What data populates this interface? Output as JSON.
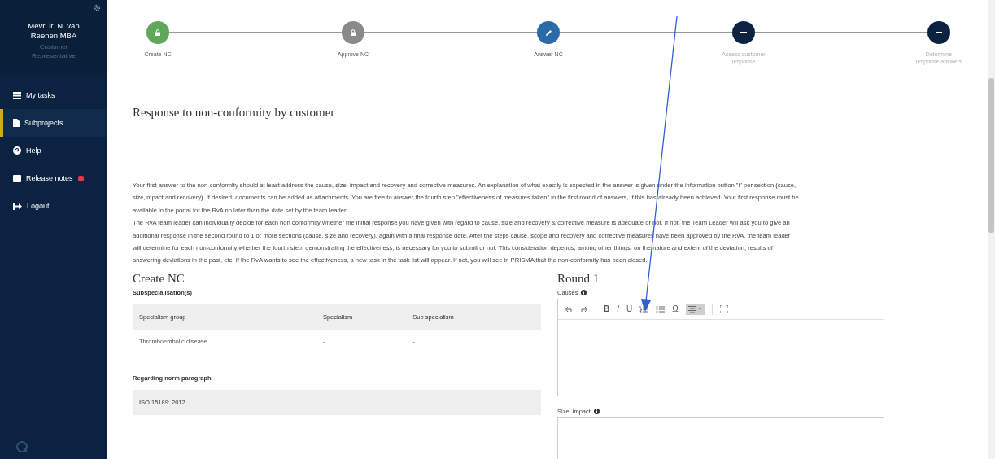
{
  "sidebar": {
    "user_name": "Mevr. ir. N. van Reenen MBA",
    "user_role": "Customer Representative",
    "items": [
      {
        "label": "My tasks",
        "selected": false,
        "badge": false
      },
      {
        "label": "Subprojects",
        "selected": true,
        "badge": false
      },
      {
        "label": "Help",
        "selected": false,
        "badge": false
      },
      {
        "label": "Release notes",
        "selected": false,
        "badge": true
      },
      {
        "label": "Logout",
        "selected": false,
        "badge": false
      }
    ]
  },
  "steps": [
    {
      "label": "Create NC",
      "kind": "done"
    },
    {
      "label": "Approve NC",
      "kind": "approved"
    },
    {
      "label": "Answer NC",
      "kind": "current"
    },
    {
      "label": "Assess customer response",
      "kind": "pending"
    },
    {
      "label": "Determine response answers",
      "kind": "pending"
    }
  ],
  "page_title": "Response to non-conformity by customer",
  "intro": [
    "Your first answer to the non-conformity should at least address the cause, size, impact and recovery and corrective measures. An explanation of what exactly is expected in the answer is given under the information button \"i\" per section (cause, size,impact and recovery). If desired, documents can be added as attachments. You are free to answer the fourth step \"effectiveness of measures taken\" in the first round of answers, if this has already been achieved. Your first response must be available in the portal for the RvA no later than the date set by the team leader.",
    "The RvA team leader can individually decide for each non conformity whether the initial response you have given with regard to cause, size and recovery & corrective measure is adequate or not. If not, the Team Leader will ask you to give an additional response in the second round to 1 or more sections (cause, size and recovery), again with a final response date. After the steps cause, scope and recovery and corrective measures have been approved by the RvA, the team leader will determine for each non-conformity whether the fourth step, demonstrating the effectiveness, is necessary for you to submit or not. This consideration depends, among other things, on the nature and extent of the deviation, results of answering deviations in the past, etc. If the RvA wants to see the effectiveness, a new task in the task list will appear. If not, you will see in PRISMA that the non-conformity has been closed."
  ],
  "create_nc": {
    "title": "Create NC",
    "subspecialisations_label": "Subspecialisation(s)",
    "table": {
      "columns": [
        "Specialism group",
        "Specialism",
        "Sub specialism"
      ],
      "rows": [
        [
          "Thromboembolic disease",
          "-",
          "-"
        ]
      ]
    },
    "norm_label": "Regarding norm paragraph",
    "norm_value": "ISO 15189: 2012"
  },
  "round": {
    "title": "Round 1",
    "fields": [
      {
        "label": "Causes",
        "toolbar": [
          {
            "kind": "undo"
          },
          {
            "kind": "redo"
          },
          {
            "kind": "text",
            "label": "B"
          },
          {
            "kind": "text",
            "label": "I"
          },
          {
            "kind": "text",
            "label": "U"
          },
          {
            "kind": "ol"
          },
          {
            "kind": "ul"
          },
          {
            "kind": "text",
            "label": "Ω"
          },
          {
            "kind": "align",
            "active": true
          },
          {
            "kind": "fullscreen"
          }
        ]
      },
      {
        "label": "Size, impact"
      }
    ]
  }
}
